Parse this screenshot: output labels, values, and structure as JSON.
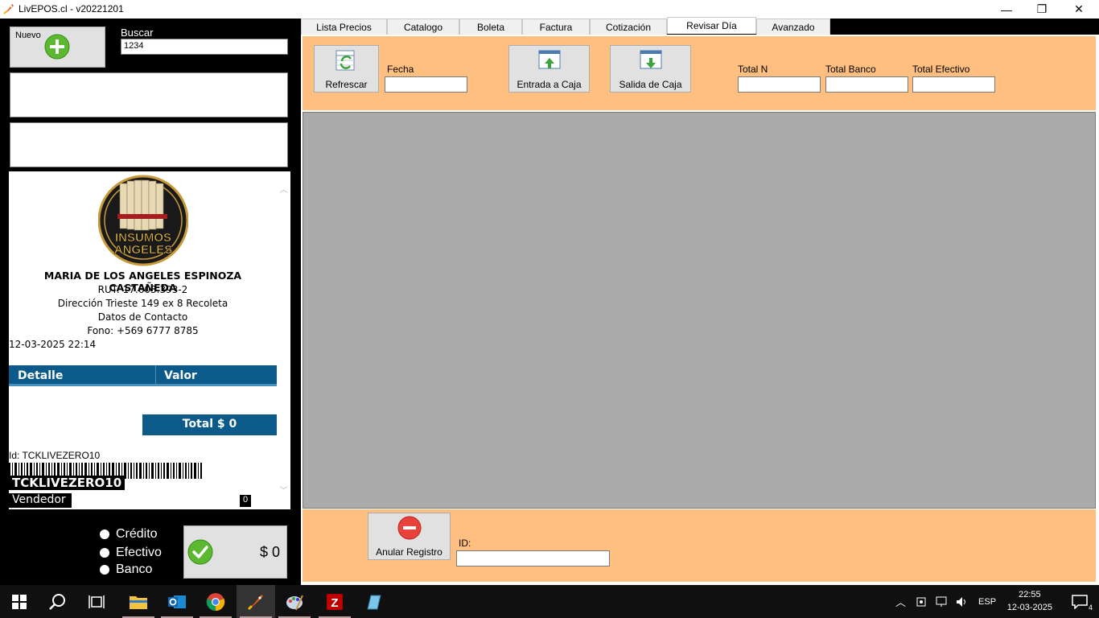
{
  "window": {
    "title": "LivEPOS.cl - v20221201",
    "minimize": "—",
    "restore": "❐",
    "close": "✕"
  },
  "left": {
    "nuevo_label": "Nuevo",
    "buscar_label": "Buscar",
    "buscar_value": "1234",
    "ticket": {
      "owner": "MARIA DE LOS ANGELES ESPINOZA CASTAÑEDA",
      "rut": "RUT: 17.603.393-2",
      "direccion": "Dirección Trieste 149 ex 8 Recoleta",
      "contacto": "Datos de Contacto",
      "fono": "Fono: +569 6777 8785",
      "datetime": "12-03-2025 22:14",
      "col_detalle": "Detalle",
      "col_valor": "Valor",
      "total": "Total $ 0",
      "id_line": "Id: TCKLIVEZERO10",
      "code": "TCKLIVEZERO10",
      "vendedor_label": "Vendedor",
      "vendedor_value": "0",
      "logo_text_1": "INSUMOS",
      "logo_text_2": "ANGELES"
    },
    "payment": {
      "credito": "Crédito",
      "efectivo": "Efectivo",
      "banco": "Banco",
      "amount": "$ 0"
    }
  },
  "tabs": [
    {
      "label": "Lista Precios"
    },
    {
      "label": "Catalogo"
    },
    {
      "label": "Boleta"
    },
    {
      "label": "Factura"
    },
    {
      "label": "Cotización"
    },
    {
      "label": "Revisar Día",
      "active": true
    },
    {
      "label": "Avanzado"
    }
  ],
  "revisar": {
    "refrescar": "Refrescar",
    "fecha_label": "Fecha",
    "fecha_value": "",
    "entrada": "Entrada a Caja",
    "salida": "Salida de Caja",
    "total_n_label": "Total N",
    "total_banco_label": "Total Banco",
    "total_efectivo_label": "Total Efectivo",
    "anular": "Anular Registro",
    "id_label": "ID:"
  },
  "taskbar": {
    "items": [
      "windows-start",
      "search",
      "task-view",
      "file-explorer",
      "outlook",
      "chrome",
      "livepos",
      "paint",
      "filezilla",
      "notepad-app"
    ],
    "tray_lang": "ESP",
    "time": "22:55",
    "date": "12-03-2025",
    "notifications": "4"
  },
  "colors": {
    "accent_orange": "#ffbf80",
    "ticket_header": "#0b5a8a",
    "grid_gray": "#ababab"
  }
}
